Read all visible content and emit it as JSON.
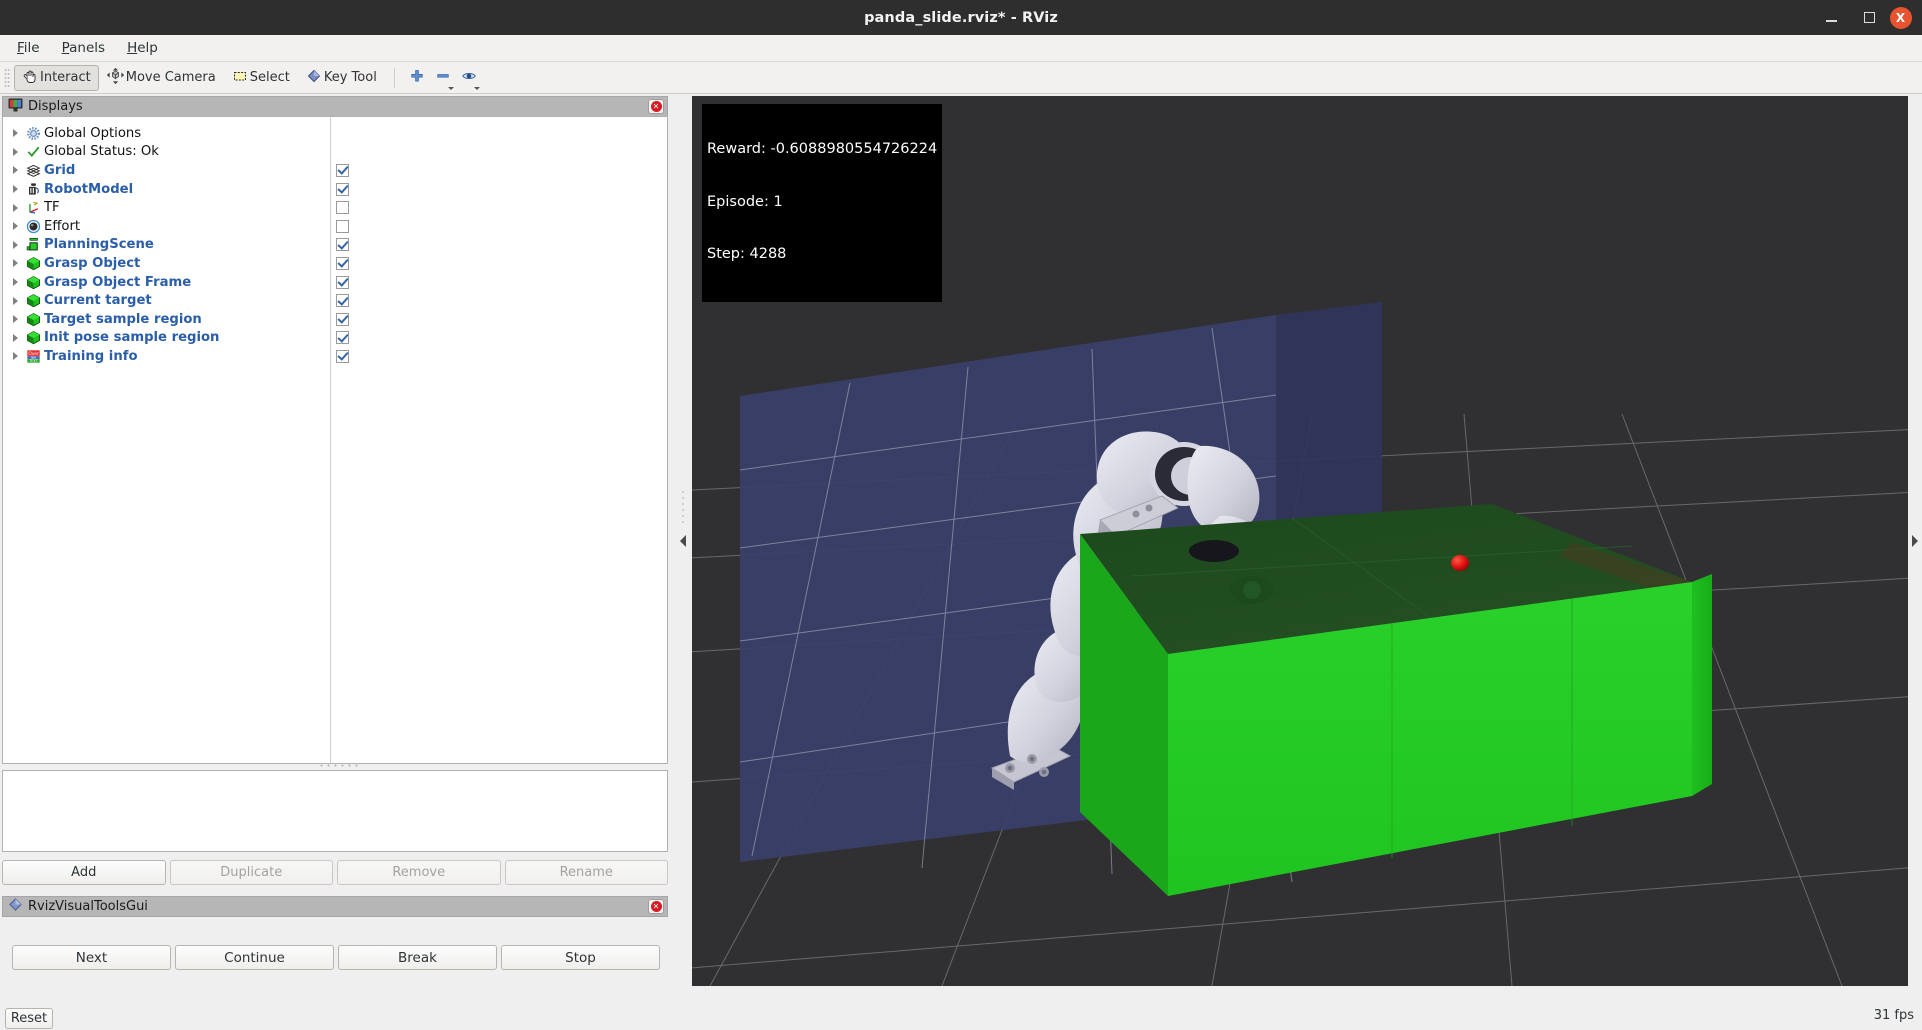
{
  "window": {
    "title": "panda_slide.rviz* - RViz",
    "controls": {
      "minimize": "minimize-icon",
      "maximize": "maximize-icon",
      "close": "X"
    }
  },
  "menubar": {
    "items": [
      {
        "label": "File",
        "mnemonic": "F"
      },
      {
        "label": "Panels",
        "mnemonic": "P"
      },
      {
        "label": "Help",
        "mnemonic": "H"
      }
    ]
  },
  "toolbar": {
    "tools": [
      {
        "label": "Interact",
        "icon": "hand-cursor-icon",
        "active": true
      },
      {
        "label": "Move Camera",
        "icon": "move-camera-icon",
        "active": false
      },
      {
        "label": "Select",
        "icon": "select-rect-icon",
        "active": false
      },
      {
        "label": "Key Tool",
        "icon": "diamond-key-icon",
        "active": false
      }
    ],
    "icon_buttons": [
      {
        "icon": "plus-icon",
        "has_dropdown": false
      },
      {
        "icon": "minus-icon",
        "has_dropdown": true
      },
      {
        "icon": "eye-icon",
        "has_dropdown": true
      }
    ]
  },
  "displays_panel": {
    "title": "Displays",
    "title_icon": "monitor-icon",
    "close_icon": "close-icon",
    "items": [
      {
        "label": "Global Options",
        "icon": "gear-icon",
        "styled": false,
        "checkbox": null
      },
      {
        "label": "Global Status: Ok",
        "icon": "check-icon",
        "styled": false,
        "checkbox": null
      },
      {
        "label": "Grid",
        "icon": "grid-icon",
        "styled": true,
        "checkbox": true
      },
      {
        "label": "RobotModel",
        "icon": "robot-icon",
        "styled": true,
        "checkbox": true
      },
      {
        "label": "TF",
        "icon": "tf-axes-icon",
        "styled": false,
        "checkbox": false
      },
      {
        "label": "Effort",
        "icon": "effort-icon",
        "styled": false,
        "checkbox": false
      },
      {
        "label": "PlanningScene",
        "icon": "planningscene-icon",
        "styled": true,
        "checkbox": true
      },
      {
        "label": "Grasp Object",
        "icon": "green-cube-icon",
        "styled": true,
        "checkbox": true
      },
      {
        "label": "Grasp Object Frame",
        "icon": "green-cube-icon",
        "styled": true,
        "checkbox": true
      },
      {
        "label": "Current target",
        "icon": "green-cube-icon",
        "styled": true,
        "checkbox": true
      },
      {
        "label": "Target sample region",
        "icon": "green-cube-icon",
        "styled": true,
        "checkbox": true
      },
      {
        "label": "Init pose sample region",
        "icon": "green-cube-icon",
        "styled": true,
        "checkbox": true
      },
      {
        "label": "Training info",
        "icon": "overlay-text-icon",
        "styled": true,
        "checkbox": true
      }
    ],
    "buttons": [
      {
        "label": "Add",
        "enabled": true
      },
      {
        "label": "Duplicate",
        "enabled": false
      },
      {
        "label": "Remove",
        "enabled": false
      },
      {
        "label": "Rename",
        "enabled": false
      }
    ]
  },
  "visual_tools_panel": {
    "title": "RvizVisualToolsGui",
    "title_icon": "diamond-icon",
    "close_icon": "close-icon",
    "buttons": [
      {
        "label": "Next"
      },
      {
        "label": "Continue"
      },
      {
        "label": "Break"
      },
      {
        "label": "Stop"
      }
    ]
  },
  "status_bar": {
    "reset_label": "Reset",
    "fps": "31 fps"
  },
  "render_view": {
    "overlay": {
      "reward_line": "Reward: -0.6088980554726224",
      "episode_line": "Episode: 1",
      "step_line": "Step: 4288"
    },
    "colors": {
      "background": "#303033",
      "planning_scene_box": "#3a3f6b",
      "grasp_object_green": "#22cc22",
      "target_marker_red": "#e01010",
      "robot_white": "#d7d7e2",
      "grid_line": "#9a9a9a"
    },
    "collapse_left_icon": "chevron-left-icon",
    "collapse_right_icon": "chevron-right-icon"
  }
}
